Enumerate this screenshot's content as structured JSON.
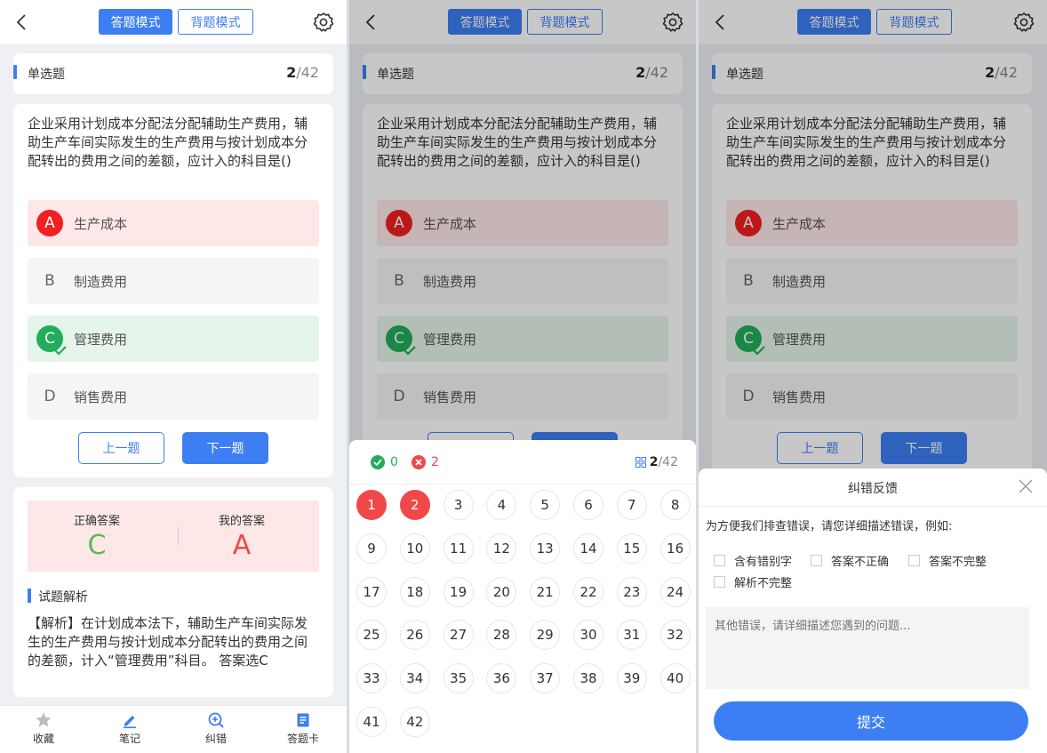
{
  "header": {
    "mode_answer": "答题模式",
    "mode_recite": "背题模式"
  },
  "question": {
    "type": "单选题",
    "current": "2",
    "total": "/42",
    "text": "企业采用计划成本分配法分配辅助生产费用，辅助生产车间实际发生的生产费用与按计划成本分配转出的费用之间的差额，应计入的科目是()",
    "options": [
      {
        "letter": "A",
        "label": "生产成本",
        "state": "wrong"
      },
      {
        "letter": "B",
        "label": "制造费用",
        "state": "normal"
      },
      {
        "letter": "C",
        "label": "管理费用",
        "state": "right"
      },
      {
        "letter": "D",
        "label": "销售费用",
        "state": "normal"
      }
    ],
    "prev_label": "上一题",
    "next_label": "下一题"
  },
  "answer": {
    "correct_label": "正确答案",
    "correct_value": "C",
    "mine_label": "我的答案",
    "mine_value": "A",
    "analysis_title": "试题解析",
    "analysis_text": "【解析】在计划成本法下，辅助生产车间实际发生的生产费用与按计划成本分配转出的费用之间的差额，计入“管理费用”科目。 答案选C"
  },
  "tabs": [
    {
      "label": "收藏",
      "icon": "star-icon"
    },
    {
      "label": "笔记",
      "icon": "pen-icon"
    },
    {
      "label": "纠错",
      "icon": "error-correct-icon"
    },
    {
      "label": "答题卡",
      "icon": "answer-card-icon"
    }
  ],
  "answer_card": {
    "correct_count": "0",
    "wrong_count": "2",
    "current": "2",
    "total": "/42",
    "numbers": [
      "1",
      "2",
      "3",
      "4",
      "5",
      "6",
      "7",
      "8",
      "9",
      "10",
      "11",
      "12",
      "13",
      "14",
      "15",
      "16",
      "17",
      "18",
      "19",
      "20",
      "21",
      "22",
      "23",
      "24",
      "25",
      "26",
      "27",
      "28",
      "29",
      "30",
      "31",
      "32",
      "33",
      "34",
      "35",
      "36",
      "37",
      "38",
      "39",
      "40",
      "41",
      "42"
    ],
    "wrong_numbers": [
      "1",
      "2"
    ]
  },
  "feedback": {
    "title": "纠错反馈",
    "prompt": "为方便我们排查错误，请您详细描述错误，例如:",
    "options": [
      "含有错别字",
      "答案不正确",
      "答案不完整",
      "解析不完整"
    ],
    "placeholder": "其他错误，请详细描述您遇到的问题...",
    "submit": "提交"
  },
  "colors": {
    "accent": "#3d7ef2",
    "wrong": "#f04848",
    "right": "#21ad5a"
  }
}
